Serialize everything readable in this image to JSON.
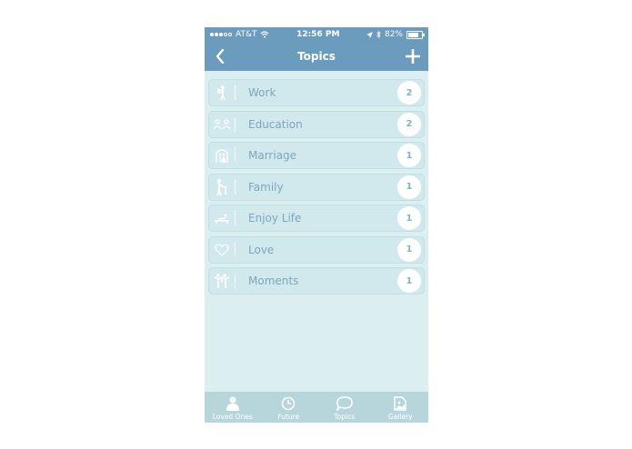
{
  "status_bar": {
    "carrier": "AT&T",
    "time": "12:56 PM",
    "battery": "82%",
    "battery_level": 0.82
  },
  "nav": {
    "title": "Topics",
    "back_icon": "chevron-left-icon",
    "add_icon": "plus-icon"
  },
  "topics": [
    {
      "label": "Work",
      "count": "2",
      "icon": "work-icon"
    },
    {
      "label": "Education",
      "count": "2",
      "icon": "education-icon"
    },
    {
      "label": "Marriage",
      "count": "1",
      "icon": "marriage-icon"
    },
    {
      "label": "Family",
      "count": "1",
      "icon": "family-icon"
    },
    {
      "label": "Enjoy Life",
      "count": "1",
      "icon": "enjoy-life-icon"
    },
    {
      "label": "Love",
      "count": "1",
      "icon": "heart-icon"
    },
    {
      "label": "Moments",
      "count": "1",
      "icon": "moments-icon"
    }
  ],
  "tabbar": [
    {
      "label": "Loved Ones",
      "icon": "person-icon"
    },
    {
      "label": "Future",
      "icon": "clock-icon"
    },
    {
      "label": "Topics",
      "icon": "speech-bubble-icon"
    },
    {
      "label": "Gallery",
      "icon": "gallery-icon"
    }
  ],
  "colors": {
    "nav": "#6b9bbd",
    "background": "#dbeff1",
    "row": "#d1e9ec",
    "label": "#7fa5bd",
    "tabbar": "#b7d6dc"
  }
}
